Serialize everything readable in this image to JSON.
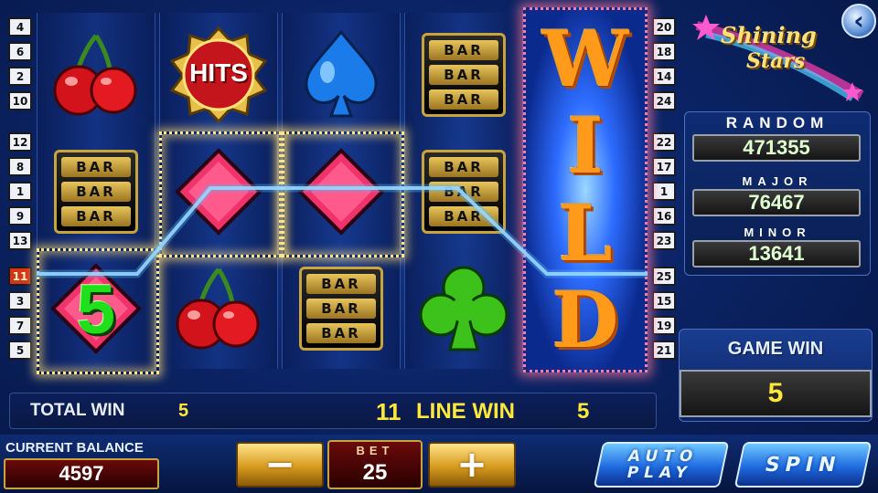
{
  "logo": {
    "line1": "Shining",
    "line2": "Stars"
  },
  "paylines_left": [
    "4",
    "6",
    "2",
    "10",
    "12",
    "8",
    "1",
    "9",
    "13",
    "11",
    "3",
    "7",
    "5"
  ],
  "paylines_right": [
    "20",
    "18",
    "14",
    "24",
    "22",
    "17",
    "1",
    "16",
    "23",
    "25",
    "15",
    "19",
    "21"
  ],
  "active_payline": "11",
  "reels": [
    {
      "symbols": [
        "cherry",
        "bar",
        "club-5"
      ]
    },
    {
      "symbols": [
        "hits",
        "diamond",
        "cherry"
      ]
    },
    {
      "symbols": [
        "spade",
        "diamond",
        "bar"
      ]
    },
    {
      "symbols": [
        "bar",
        "bar",
        "club"
      ]
    },
    {
      "symbols": [
        "wild"
      ]
    }
  ],
  "symbols": {
    "hits_text": "HITS",
    "bar_text": "BAR",
    "five_text": "5",
    "wild_letters": [
      "W",
      "I",
      "L",
      "D"
    ]
  },
  "jackpots": {
    "random_label": "RANDOM",
    "random_value": "471355",
    "major_label": "MAJOR",
    "major_value": "76467",
    "minor_label": "MINOR",
    "minor_value": "13641"
  },
  "game_win": {
    "label": "GAME WIN",
    "value": "5"
  },
  "info": {
    "total_win_label": "TOTAL WIN",
    "total_win_value": "5",
    "line_number": "11",
    "line_win_label": "LINE WIN",
    "line_win_value": "5"
  },
  "balance": {
    "label": "CURRENT BALANCE",
    "value": "4597"
  },
  "bet": {
    "label": "BET",
    "value": "25",
    "minus": "−",
    "plus": "+"
  },
  "buttons": {
    "auto_play_line1": "AUTO",
    "auto_play_line2": "PLAY",
    "spin": "SPIN",
    "back": "‹"
  },
  "colors": {
    "gold": "#e7c55b",
    "win_line": "#8fd8ff",
    "wild": "#ff9a1a"
  }
}
